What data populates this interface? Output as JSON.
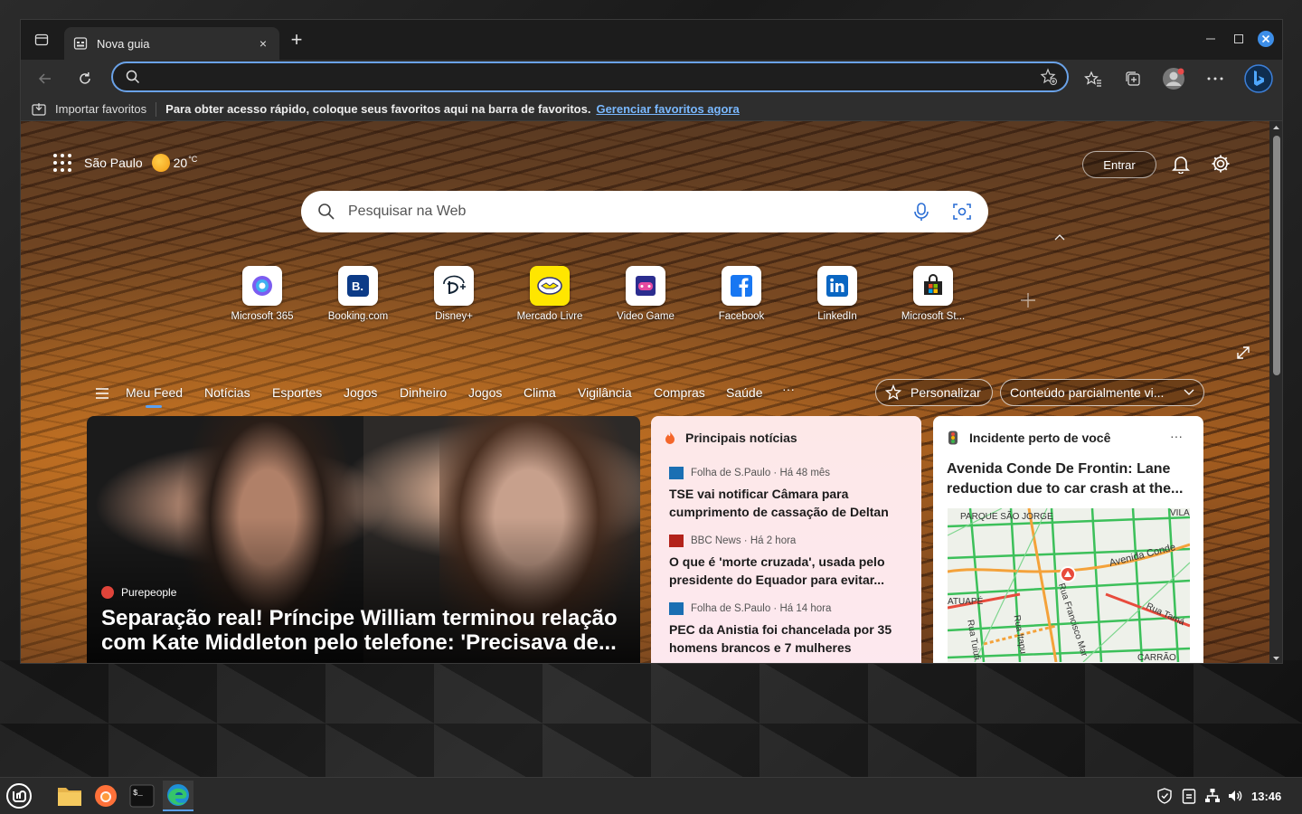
{
  "tab": {
    "title": "Nova guia",
    "close": "×",
    "new": "+"
  },
  "address": {
    "placeholder": "",
    "value": ""
  },
  "favorites_bar": {
    "import_label": "Importar favoritos",
    "hint": "Para obter acesso rápido, coloque seus favoritos aqui na barra de favoritos.",
    "manage_link": "Gerenciar favoritos agora"
  },
  "newtab": {
    "location": "São Paulo",
    "temperature": "20",
    "temp_unit": "°C",
    "signin_label": "Entrar",
    "search_placeholder": "Pesquisar na Web",
    "quick_links": [
      {
        "label": "Microsoft 365",
        "icon": "microsoft365-icon"
      },
      {
        "label": "Booking.com",
        "icon": "booking-icon"
      },
      {
        "label": "Disney+",
        "icon": "disney-icon"
      },
      {
        "label": "Mercado Livre",
        "icon": "mercadolivre-icon"
      },
      {
        "label": "Video Game",
        "icon": "videogame-icon"
      },
      {
        "label": "Facebook",
        "icon": "facebook-icon"
      },
      {
        "label": "LinkedIn",
        "icon": "linkedin-icon"
      },
      {
        "label": "Microsoft St...",
        "icon": "microsoft-store-icon"
      }
    ],
    "feed_tabs": [
      "Meu Feed",
      "Notícias",
      "Esportes",
      "Jogos",
      "Dinheiro",
      "Jogos",
      "Clima",
      "Vigilância",
      "Compras",
      "Saúde",
      "···"
    ],
    "personalize_label": "Personalizar",
    "content_filter_label": "Conteúdo parcialmente vi..."
  },
  "hero": {
    "source": "Purepeople",
    "headline": "Separação real! Príncipe William terminou relação com Kate Middleton pelo telefone: 'Precisava de..."
  },
  "top_news": {
    "title": "Principais notícias",
    "items": [
      {
        "meta": "Folha de S.Paulo · Há 48 mês",
        "title": "TSE vai notificar Câmara para cumprimento de cassação de Deltan",
        "logo_color": "#1a6fb3"
      },
      {
        "meta": "BBC News · Há 2 hora",
        "title": "O que é 'morte cruzada', usada pelo presidente do Equador para evitar...",
        "logo_color": "#b3221a"
      },
      {
        "meta": "Folha de S.Paulo · Há 14 hora",
        "title": "PEC da Anistia foi chancelada por 35 homens brancos e 7 mulheres",
        "logo_color": "#1a6fb3"
      }
    ]
  },
  "incident": {
    "title": "Incidente perto de você",
    "more": "···",
    "headline": "Avenida Conde De Frontin: Lane reduction due to car crash at the...",
    "map_labels": [
      "PARQUE SÃO JORGE",
      "VILA",
      "Avenida Conde",
      "ATUAPÉ",
      "Rua Francisco Mar",
      "Rua Itapu",
      "Rua Tuiuti",
      "Rua Tamá",
      "CARRÃO"
    ]
  },
  "taskbar": {
    "time": "13:46"
  },
  "colors": {
    "accent": "#6aa2e8",
    "link": "#79b8ff"
  }
}
